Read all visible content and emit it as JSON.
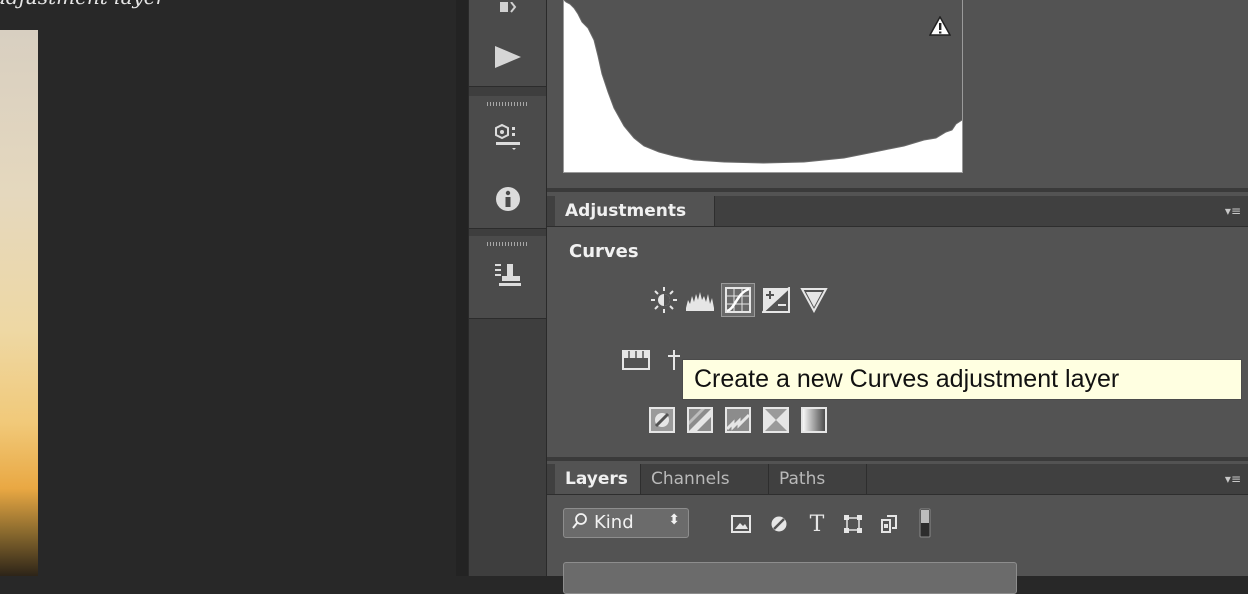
{
  "document": {
    "caption": "adjustment layer"
  },
  "dock_icons": [
    {
      "name": "actions-icon"
    },
    {
      "name": "play-icon"
    },
    {
      "name": "properties-icon"
    },
    {
      "name": "info-icon"
    },
    {
      "name": "clone-source-icon"
    }
  ],
  "histogram": {
    "warning_icon": "warning-icon"
  },
  "adjustments_panel": {
    "tab_label": "Adjustments",
    "section_title": "Curves",
    "row1_icons": [
      "brightness-contrast-icon",
      "levels-icon",
      "curves-icon",
      "exposure-icon",
      "vibrance-icon"
    ],
    "row2_icons": [
      "hue-saturation-icon",
      "color-balance-icon"
    ],
    "row3_icons": [
      "invert-icon",
      "posterize-icon",
      "threshold-icon",
      "selective-color-icon",
      "gradient-map-icon"
    ],
    "selected_icon": "curves-icon"
  },
  "tooltip": {
    "text": "Create a new Curves adjustment layer"
  },
  "layers_panel": {
    "tabs": [
      "Layers",
      "Channels",
      "Paths"
    ],
    "active_tab": "Layers",
    "kind_filter": "Kind",
    "filter_icons": [
      "pixel-filter-icon",
      "adjustment-filter-icon",
      "type-filter-icon",
      "shape-filter-icon",
      "smart-object-filter-icon",
      "filter-toggle-icon"
    ]
  },
  "colors": {
    "panel_bg": "#535353",
    "tooltip_bg": "#ffffe1",
    "histogram_fill": "#535353"
  }
}
